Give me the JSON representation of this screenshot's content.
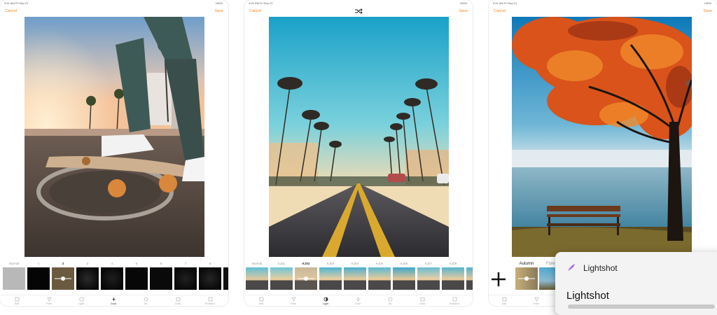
{
  "screens": [
    {
      "status": {
        "time": "9:41 AM",
        "date": "Fri Sep 21",
        "battery": "100%"
      },
      "nav": {
        "cancel": "Cancel",
        "save": "Save"
      },
      "filters": [
        "Normal",
        "1",
        "2",
        "3",
        "4",
        "5",
        "6",
        "7",
        "8"
      ],
      "selected_filter": "2",
      "tabs": [
        "Edit",
        "Filter",
        "Light",
        "Dust",
        "3D",
        "Data",
        "Rotation"
      ],
      "active_tab": "Dust"
    },
    {
      "status": {
        "time": "4:20 PM",
        "date": "Fri Sep 21",
        "battery": "100%"
      },
      "nav": {
        "cancel": "Cancel",
        "save": "Save"
      },
      "filters": [
        "Normal",
        "KJ01",
        "KJ02",
        "KJ03",
        "KJ04",
        "KJ05",
        "KJ06",
        "KJ07",
        "KJ08"
      ],
      "selected_filter": "KJ02",
      "tabs": [
        "Edit",
        "Filter",
        "Light",
        "Dust",
        "3D",
        "Data",
        "Rotation"
      ],
      "active_tab": "Light"
    },
    {
      "status": {
        "time": "9:41 AM",
        "date": "Fri Sep 21",
        "battery": "100%"
      },
      "nav": {
        "cancel": "Cancel",
        "save": "Save"
      },
      "filters": [
        "Autumn",
        "Forest"
      ],
      "selected_filter": "Autumn",
      "tabs": [
        "Edit",
        "Filter"
      ]
    }
  ],
  "popup": {
    "brand": "Lightshot",
    "title": "Lightshot"
  },
  "colors": {
    "accent": "#f08a24",
    "popup_icon": "#9b5de5"
  }
}
